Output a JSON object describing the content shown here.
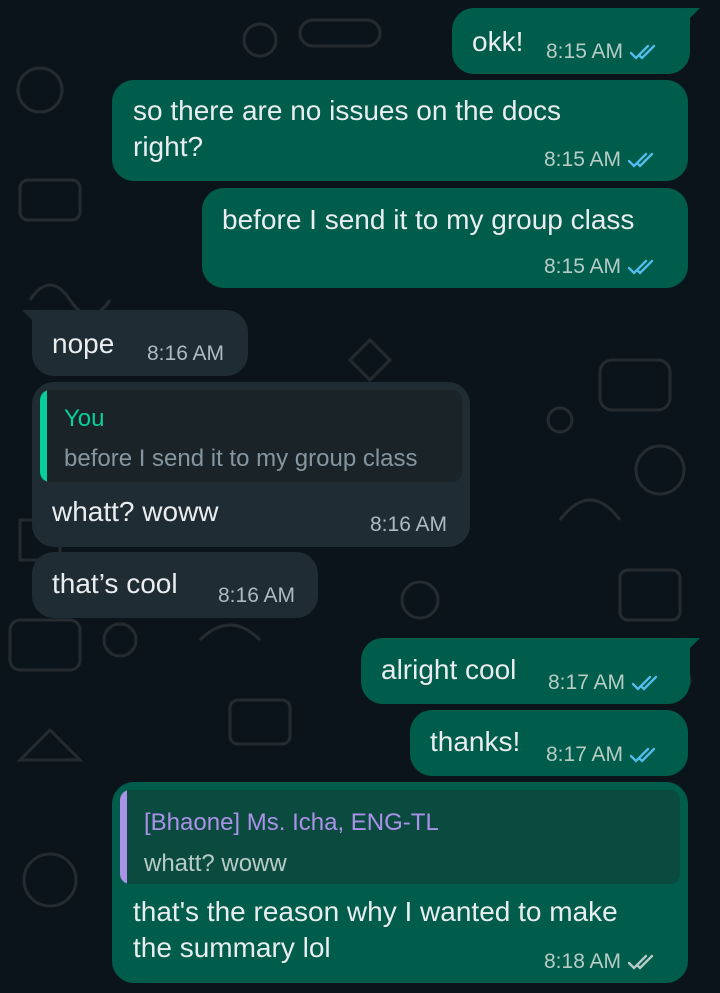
{
  "messages": [
    {
      "text": "okk!",
      "time": "8:15 AM",
      "status": "read"
    },
    {
      "line1": "so there are no issues on the docs",
      "line2": "right?",
      "time": "8:15 AM",
      "status": "read"
    },
    {
      "text": "before I send it to my group class",
      "time": "8:15 AM",
      "status": "read"
    },
    {
      "text": "nope",
      "time": "8:16 AM"
    },
    {
      "quote_name": "You",
      "quote_text": "before I send it to my group class",
      "text": "whatt? woww",
      "time": "8:16 AM"
    },
    {
      "text": "that’s cool",
      "time": "8:16 AM"
    },
    {
      "text": "alright cool",
      "time": "8:17 AM",
      "status": "read"
    },
    {
      "text": "thanks!",
      "time": "8:17 AM",
      "status": "read"
    },
    {
      "quote_name": "[Bhaone] Ms. Icha, ENG-TL",
      "quote_text": "whatt? woww",
      "line1": "that's the reason why I wanted to make",
      "line2": "the summary lol",
      "time": "8:18 AM",
      "status": "delivered"
    }
  ],
  "colors": {
    "background": "#0b141a",
    "outgoing_bubble": "#005c4b",
    "incoming_bubble": "#202c33",
    "read_ticks": "#53bdeb",
    "delivered_ticks": "#b7ccc6",
    "quote_you": "#06cf9c",
    "quote_other": "#a992e8"
  }
}
